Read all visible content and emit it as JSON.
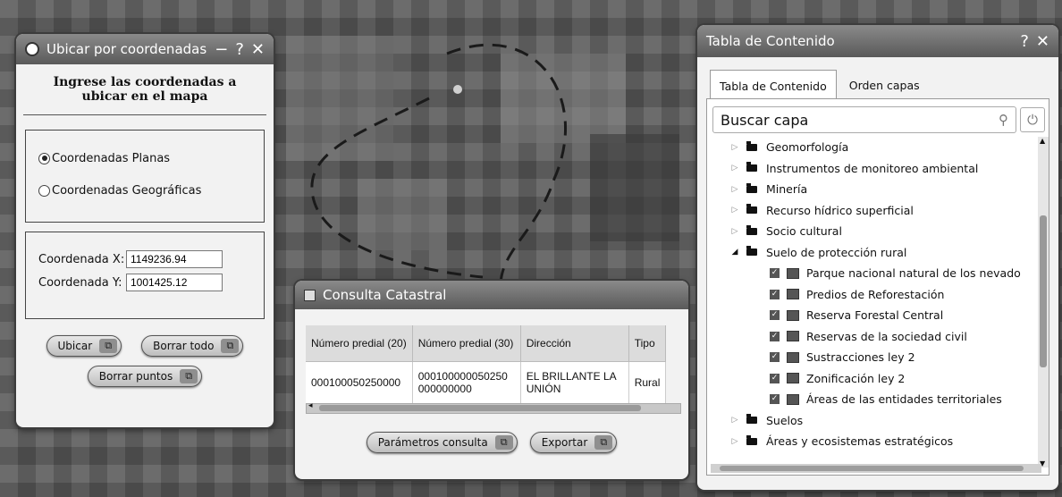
{
  "colors": {
    "title_bar": "#6e6e6e",
    "panel_bg": "#f2f2f2",
    "map_bg": "#5e5e5e"
  },
  "coord_panel": {
    "title": "Ubicar por coordenadas",
    "minimize": "−",
    "help": "?",
    "close": "✕",
    "heading": "Ingrese las coordenadas a ubicar en el mapa",
    "radio_planas": "Coordenadas Planas",
    "radio_geograficas": "Coordenadas Geográficas",
    "selected": "Coordenadas Planas",
    "x_label": "Coordenada X:",
    "x_value": "1149236.94",
    "y_label": "Coordenada Y:",
    "y_value": "1001425.12",
    "btn_ubicar": "Ubicar",
    "btn_borrar_todo": "Borrar todo",
    "btn_borrar_puntos": "Borrar puntos"
  },
  "catastral_panel": {
    "title": "Consulta Catastral",
    "columns": [
      "Número predial (20)",
      "Número predial (30)",
      "Dirección",
      "Tipo"
    ],
    "rows": [
      [
        "000100050250000",
        "000100000050250 000000000",
        "EL BRILLANTE LA UNIÓN",
        "Rural"
      ]
    ],
    "btn_parametros": "Parámetros consulta",
    "btn_exportar": "Exportar"
  },
  "toc_panel": {
    "title": "Tabla de Contenido",
    "help": "?",
    "close": "✕",
    "tabs": [
      "Tabla de Contenido",
      "Orden capas"
    ],
    "search_placeholder": "Buscar capa",
    "items": [
      {
        "label": "Geomorfología",
        "type": "folder",
        "expanded": false
      },
      {
        "label": "Instrumentos de monitoreo ambiental",
        "type": "folder",
        "expanded": false
      },
      {
        "label": "Minería",
        "type": "folder",
        "expanded": false
      },
      {
        "label": "Recurso hídrico superficial",
        "type": "folder",
        "expanded": false
      },
      {
        "label": "Socio cultural",
        "type": "folder",
        "expanded": false
      },
      {
        "label": "Suelo de protección rural",
        "type": "folder",
        "expanded": true
      },
      {
        "label": "Parque nacional natural de los nevado",
        "type": "layer",
        "checked": true
      },
      {
        "label": "Predios de Reforestación",
        "type": "layer",
        "checked": true
      },
      {
        "label": "Reserva Forestal Central",
        "type": "layer",
        "checked": true
      },
      {
        "label": "Reservas de la sociedad civil",
        "type": "layer",
        "checked": true
      },
      {
        "label": "Sustracciones ley 2",
        "type": "layer",
        "checked": true
      },
      {
        "label": "Zonificación ley 2",
        "type": "layer",
        "checked": true
      },
      {
        "label": "Áreas de las entidades territoriales",
        "type": "layer",
        "checked": true
      },
      {
        "label": "Suelos",
        "type": "folder",
        "expanded": false
      },
      {
        "label": "Áreas y ecosistemas estratégicos",
        "type": "folder",
        "expanded": false
      }
    ]
  }
}
